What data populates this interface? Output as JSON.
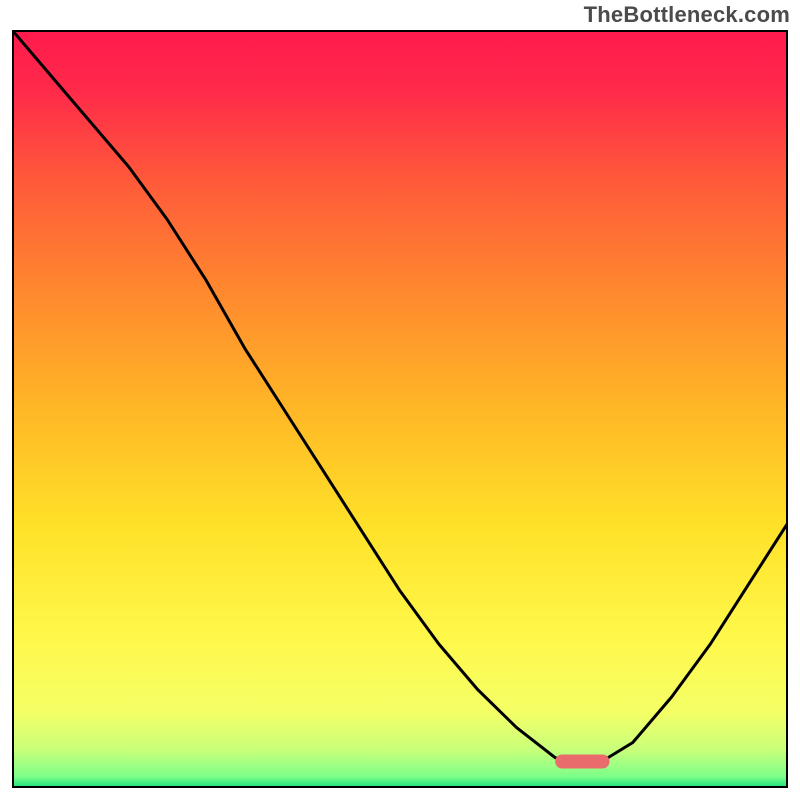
{
  "watermark": "TheBottleneck.com",
  "chart_data": {
    "type": "line",
    "title": "",
    "xlabel": "",
    "ylabel": "",
    "xlim": [
      0,
      100
    ],
    "ylim": [
      0,
      100
    ],
    "series": [
      {
        "name": "bottleneck-curve",
        "x": [
          0,
          5,
          10,
          15,
          20,
          25,
          30,
          35,
          40,
          45,
          50,
          55,
          60,
          65,
          70,
          72,
          76,
          80,
          85,
          90,
          95,
          100
        ],
        "values": [
          100,
          94,
          88,
          82,
          75,
          67,
          58,
          50,
          42,
          34,
          26,
          19,
          13,
          8,
          4,
          3.5,
          3.5,
          6,
          12,
          19,
          27,
          35
        ]
      }
    ],
    "minimum_marker": {
      "x_start": 70,
      "x_end": 77,
      "y": 3.5,
      "color": "#ea6b6b"
    },
    "gradient_stops": [
      {
        "offset": 0.0,
        "color": "#ff1a4d"
      },
      {
        "offset": 0.08,
        "color": "#ff2a4a"
      },
      {
        "offset": 0.2,
        "color": "#ff5a3a"
      },
      {
        "offset": 0.35,
        "color": "#ff8a2e"
      },
      {
        "offset": 0.5,
        "color": "#ffb726"
      },
      {
        "offset": 0.65,
        "color": "#ffe028"
      },
      {
        "offset": 0.8,
        "color": "#fff84a"
      },
      {
        "offset": 0.9,
        "color": "#f4ff66"
      },
      {
        "offset": 0.95,
        "color": "#c8ff7a"
      },
      {
        "offset": 0.985,
        "color": "#7dff8a"
      },
      {
        "offset": 1.0,
        "color": "#13e07a"
      }
    ]
  }
}
